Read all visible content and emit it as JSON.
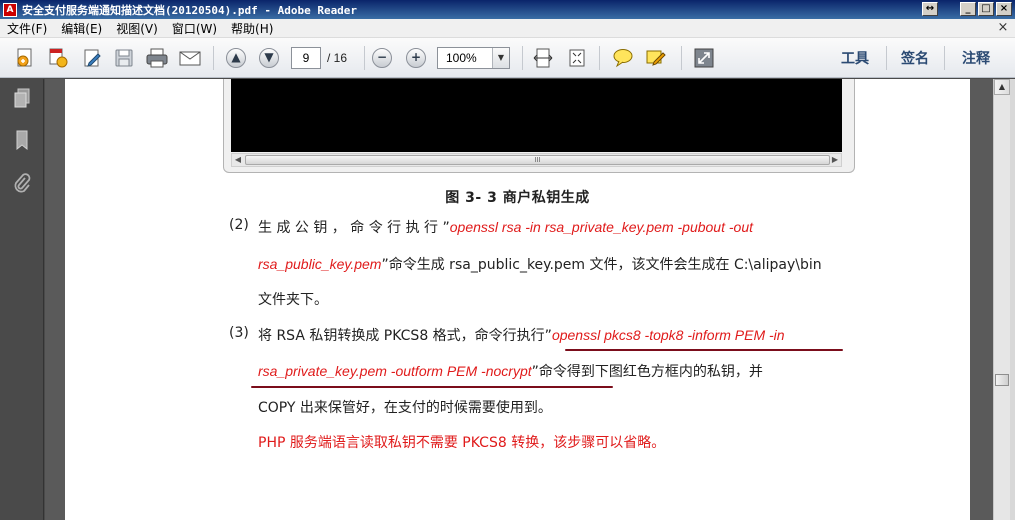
{
  "window": {
    "title": "安全支付服务端通知描述文档(20120504).pdf - Adobe Reader",
    "app_icon_text": "A",
    "buttons": {
      "restore": "↔",
      "minimize": "_",
      "maximize": "□",
      "close": "×"
    }
  },
  "menubar": {
    "items": [
      "文件(F)",
      "编辑(E)",
      "视图(V)",
      "窗口(W)",
      "帮助(H)"
    ],
    "close_glyph": "×"
  },
  "toolbar": {
    "page_current": "9",
    "page_total": "/ 16",
    "zoom": "100%",
    "zoom_out_glyph": "−",
    "zoom_in_glyph": "+",
    "prev_page_glyph": "▲",
    "next_page_glyph": "▼",
    "zoom_drop_glyph": "▼",
    "right_panels": [
      "工具",
      "签名",
      "注释"
    ]
  },
  "document": {
    "embedded_scroll_grip": "III",
    "embedded_arrow_left": "◀",
    "embedded_arrow_right": "▶",
    "figure_caption": "图 3- 3 商户私钥生成",
    "step2": {
      "number": "(2)",
      "line1_prefix": "生 成 公 钥 ， 命 令 行 执 行 ”",
      "line1_cmd": "openssl  rsa  -in  rsa_private_key.pem  -pubout  -out",
      "line2_cmd": "rsa_public_key.pem",
      "line2_rest": "”命令生成 rsa_public_key.pem 文件，该文件会生成在 C:\\alipay\\bin",
      "line3": "文件夹下。"
    },
    "step3": {
      "number": "(3)",
      "line1_prefix": "将 RSA 私钥转换成 PKCS8 格式，命令行执行”",
      "line1_cmd": "openssl  pkcs8  -topk8  -inform  PEM  -in",
      "line2_cmd": "rsa_private_key.pem  -outform  PEM  -nocrypt",
      "line2_rest": "”命令得到下图红色方框内的私钥，并",
      "line3": "COPY 出来保管好，在支付的时候需要使用到。"
    },
    "note": "PHP 服务端语言读取私钥不需要 PKCS8 转换，该步骤可以省略。"
  },
  "scrollbar": {
    "up_glyph": "▲"
  },
  "colors": {
    "accent_red": "#e01b1b",
    "underline": "#7b0d1b",
    "panel_link": "#2b4a73"
  }
}
